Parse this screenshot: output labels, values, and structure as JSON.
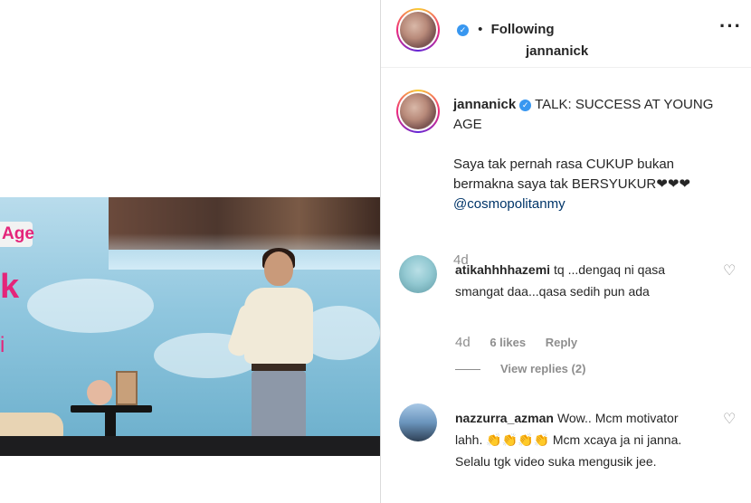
{
  "video": {
    "overlay_age": "Age",
    "overlay_k": "k",
    "overlay_i": "i"
  },
  "post": {
    "author": "jannanick",
    "follow_separator": "•",
    "follow_status": "Following",
    "more_icon": "more-horizontal-icon",
    "verified_icon": "verified-badge-icon",
    "caption_title": "TALK: SUCCESS AT YOUNG AGE",
    "caption_body": "Saya tak pernah rasa CUKUP bukan bermakna saya tak BERSYUKUR❤❤❤",
    "caption_mention": "@cosmopolitanmy",
    "caption_time": "4d"
  },
  "comments": [
    {
      "username": "atikahhhhazemi",
      "text": "tq ...dengaq ni qasa smangat daa...qasa sedih pun ada",
      "time": "4d",
      "likes": "6 likes",
      "reply": "Reply",
      "view_replies": "View replies (2)"
    },
    {
      "username": "nazzurra_azman",
      "text": "Wow.. Mcm motivator lahh. 👏👏👏👏 Mcm xcaya ja ni janna. Selalu tgk video suka mengusik jee."
    }
  ],
  "colors": {
    "accent_pink": "#e4257a",
    "verified_blue": "#3897f0",
    "mention_blue": "#003569",
    "muted_gray": "#8e8e8e"
  }
}
